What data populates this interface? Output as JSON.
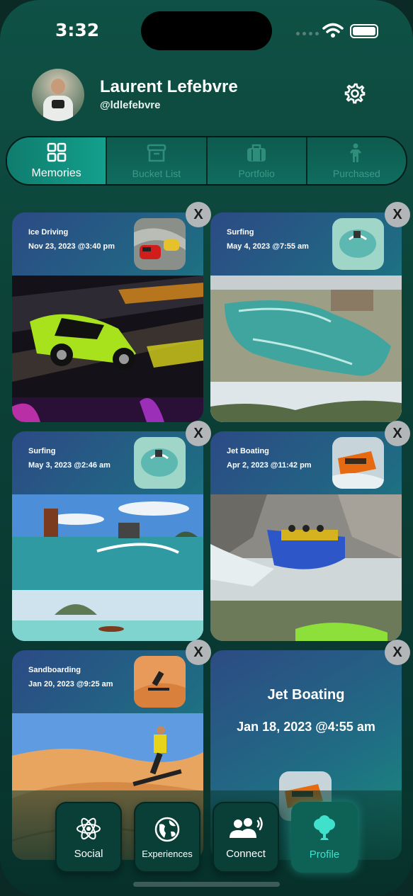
{
  "status": {
    "time": "3:32"
  },
  "profile": {
    "name": "Laurent Lefebvre",
    "handle": "@ldlefebvre"
  },
  "tabs": [
    {
      "label": "Memories",
      "icon": "grid-icon",
      "active": true
    },
    {
      "label": "Bucket List",
      "icon": "archive-box-icon",
      "active": false
    },
    {
      "label": "Portfolio",
      "icon": "suitcase-icon",
      "active": false
    },
    {
      "label": "Purchased",
      "icon": "person-icon",
      "active": false
    }
  ],
  "cards": [
    {
      "title": "Ice Driving",
      "date": "Nov 23, 2023 @3:40 pm",
      "scene": "race-car"
    },
    {
      "title": "Surfing",
      "date": "May 4, 2023 @7:55 am",
      "scene": "wave-pool"
    },
    {
      "title": "Surfing",
      "date": "May 3, 2023 @2:46 am",
      "scene": "surf-ocean"
    },
    {
      "title": "Jet Boating",
      "date": "Apr 2, 2023 @11:42 pm",
      "scene": "jet-boat"
    },
    {
      "title": "Sandboarding",
      "date": "Jan 20, 2023 @9:25 am",
      "scene": "sand-dune"
    }
  ],
  "summary_card": {
    "title": "Jet Boating",
    "date": "Jan 18, 2023 @4:55 am"
  },
  "close_glyph": "X",
  "nav": [
    {
      "label": "Social",
      "icon": "atom-icon",
      "active": false
    },
    {
      "label": "Experiences",
      "icon": "globe-icon",
      "active": false
    },
    {
      "label": "Connect",
      "icon": "people-icon",
      "active": false
    },
    {
      "label": "Profile",
      "icon": "tree-icon",
      "active": true
    }
  ],
  "colors": {
    "accent": "#13a08c",
    "active_nav_text": "#3fe0cc",
    "background": "#0c4238"
  }
}
